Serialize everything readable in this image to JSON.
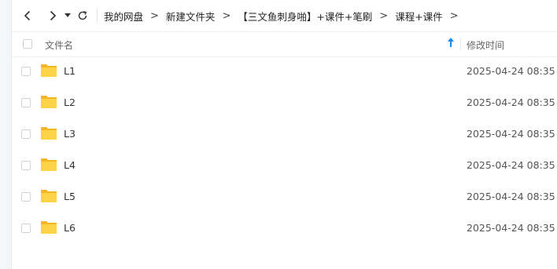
{
  "breadcrumb": [
    "我的网盘",
    "新建文件夹",
    "【三文鱼刺身啪】+课件+笔刷",
    "课程+课件"
  ],
  "table": {
    "name_header": "文件名",
    "time_header": "修改时间",
    "rows": [
      {
        "name": "L1",
        "time": "2025-04-24 08:35"
      },
      {
        "name": "L2",
        "time": "2025-04-24 08:35"
      },
      {
        "name": "L3",
        "time": "2025-04-24 08:35"
      },
      {
        "name": "L4",
        "time": "2025-04-24 08:35"
      },
      {
        "name": "L5",
        "time": "2025-04-24 08:35"
      },
      {
        "name": "L6",
        "time": "2025-04-24 08:35"
      }
    ]
  },
  "icons": {
    "back": "chevron-left-icon",
    "forward": "chevron-right-icon",
    "history": "caret-down-icon",
    "refresh": "refresh-icon",
    "sort": "sort-up-arrow-icon",
    "folder": "folder-icon"
  },
  "colors": {
    "folder": "#f7c22f",
    "sort_arrow": "#1e88e5"
  }
}
